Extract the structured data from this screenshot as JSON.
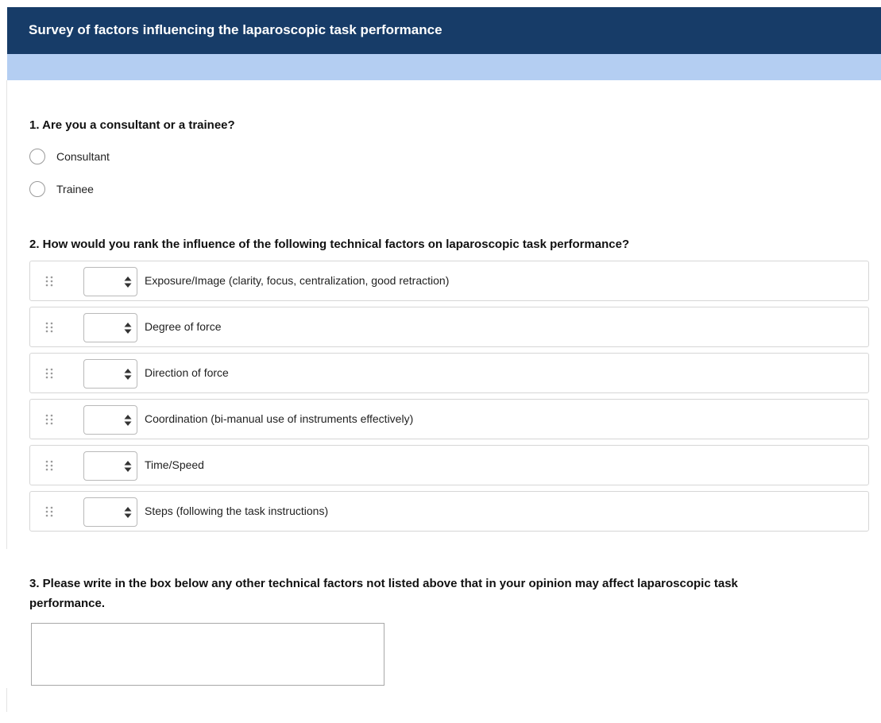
{
  "header": {
    "title": "Survey of factors influencing the laparoscopic task performance"
  },
  "questions": {
    "q1": {
      "title": "1. Are you a consultant or a trainee?",
      "options": [
        {
          "label": "Consultant",
          "selected": false
        },
        {
          "label": "Trainee",
          "selected": false
        }
      ]
    },
    "q2": {
      "title": "2. How would you rank the influence of the following technical factors on laparoscopic task performance?",
      "items": [
        {
          "label": "Exposure/Image (clarity, focus, centralization, good retraction)",
          "rank": ""
        },
        {
          "label": "Degree of force",
          "rank": ""
        },
        {
          "label": "Direction of force",
          "rank": ""
        },
        {
          "label": "Coordination (bi-manual use of instruments effectively)",
          "rank": ""
        },
        {
          "label": "Time/Speed",
          "rank": ""
        },
        {
          "label": "Steps (following the task instructions)",
          "rank": ""
        }
      ]
    },
    "q3": {
      "title": "3. Please write in the box below any other technical factors not listed above that in your opinion may affect laparoscopic task performance.",
      "value": ""
    }
  },
  "icons": {
    "drag_handle": "drag-dots-icon",
    "select_arrows": "up-down-arrows-icon"
  },
  "colors": {
    "header_bg": "#173c68",
    "progress_band": "#b4cef2",
    "header_text": "#ffffff"
  }
}
